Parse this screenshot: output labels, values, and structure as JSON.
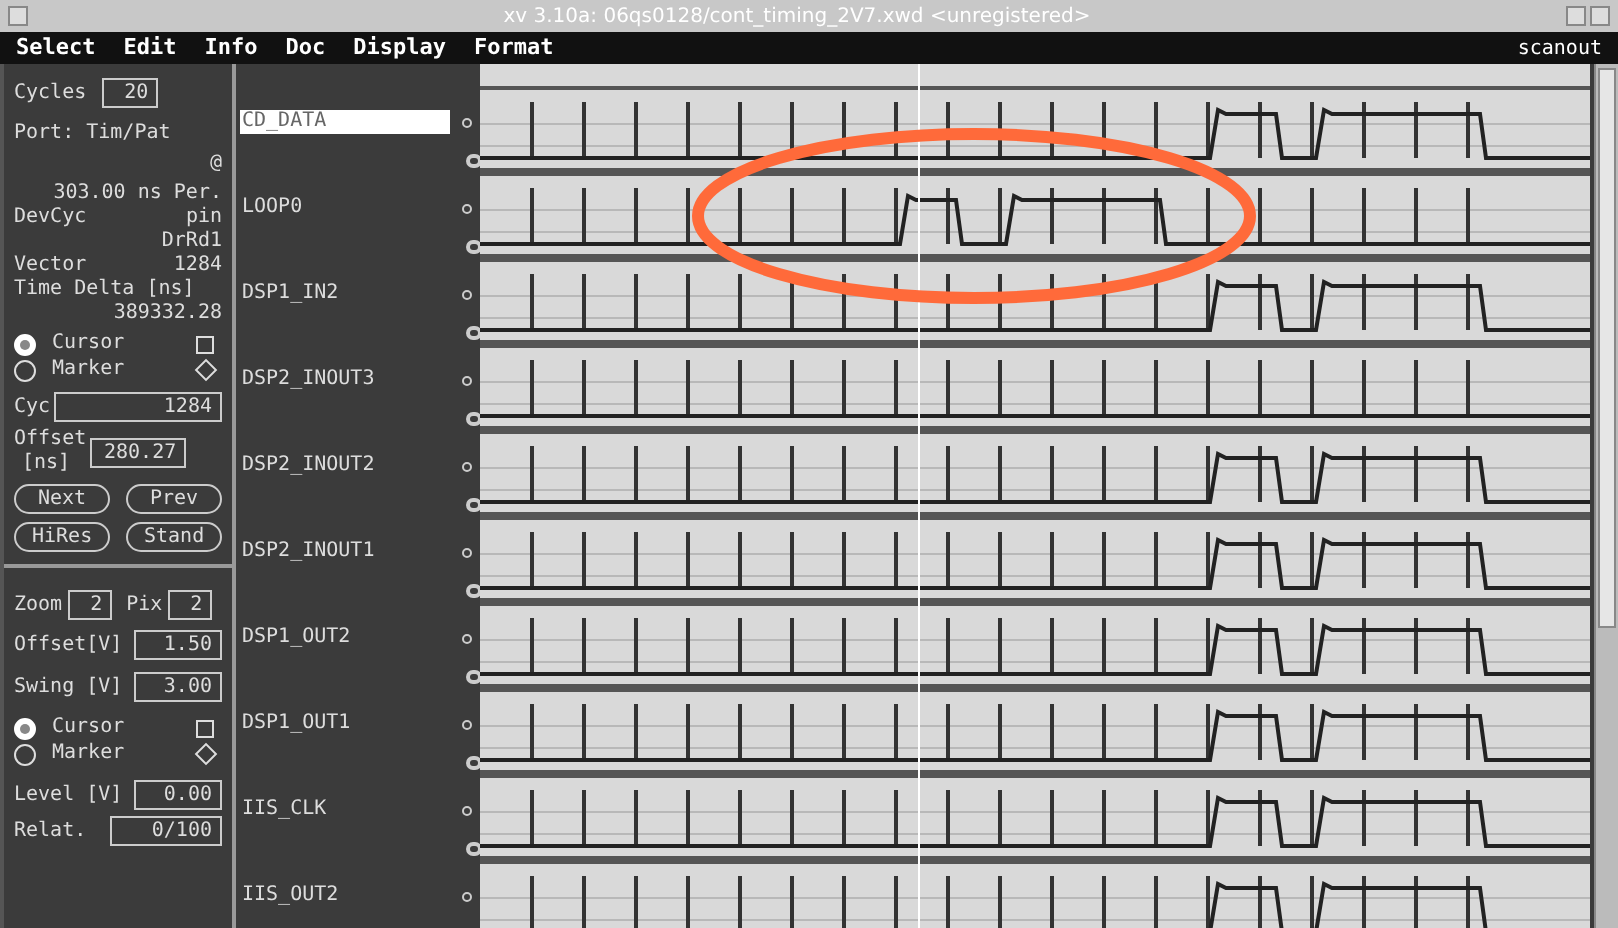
{
  "window": {
    "title": "xv 3.10a: 06qs0128/cont_timing_2V7.xwd <unregistered>"
  },
  "menu": [
    "Select",
    "Edit",
    "Info",
    "Doc",
    "Display",
    "Format"
  ],
  "menu_right": "scanout",
  "left_panel": {
    "cycles": {
      "label": "Cycles",
      "value": "20"
    },
    "port": "Port: Tim/Pat",
    "at": "@",
    "period": "303.00 ns Per.",
    "devcyc": {
      "label": "DevCyc",
      "value": "pin"
    },
    "drrd": "DrRd1",
    "vector": {
      "label": "Vector",
      "value": "1284"
    },
    "time_delta": {
      "label": "Time Delta [ns]",
      "value": "389332.28"
    },
    "radios": [
      {
        "label": "Cursor",
        "selected": true
      },
      {
        "label": "Marker",
        "selected": false
      }
    ],
    "cyc": {
      "label": "Cyc",
      "value": "1284"
    },
    "offset": {
      "label": "Offset",
      "unit": "[ns]",
      "value": "280.27"
    },
    "buttons": [
      "Next",
      "Prev",
      "HiRes",
      "Stand"
    ],
    "zoom": {
      "label": "Zoom",
      "value": "2"
    },
    "pix": {
      "label": "Pix",
      "value": "2"
    },
    "offset_v": {
      "label": "Offset[V]",
      "value": "1.50"
    },
    "swing": {
      "label": "Swing [V]",
      "value": "3.00"
    },
    "radios2": [
      {
        "label": "Cursor",
        "selected": true
      },
      {
        "label": "Marker",
        "selected": false
      }
    ],
    "level": {
      "label": "Level [V]",
      "value": "0.00"
    },
    "relat": {
      "label": "Relat.",
      "value": "0/100"
    }
  },
  "channels": [
    {
      "name": "CD_DATA",
      "selected": true,
      "kind": "late"
    },
    {
      "name": "LOOP0",
      "selected": false,
      "kind": "mid"
    },
    {
      "name": "DSP1_IN2",
      "selected": false,
      "kind": "late"
    },
    {
      "name": "DSP2_INOUT3",
      "selected": false,
      "kind": "flat"
    },
    {
      "name": "DSP2_INOUT2",
      "selected": false,
      "kind": "late"
    },
    {
      "name": "DSP2_INOUT1",
      "selected": false,
      "kind": "late"
    },
    {
      "name": "DSP1_OUT2",
      "selected": false,
      "kind": "late"
    },
    {
      "name": "DSP1_OUT1",
      "selected": false,
      "kind": "late"
    },
    {
      "name": "IIS_CLK",
      "selected": false,
      "kind": "late"
    },
    {
      "name": "IIS_OUT2",
      "selected": false,
      "kind": "late"
    }
  ]
}
